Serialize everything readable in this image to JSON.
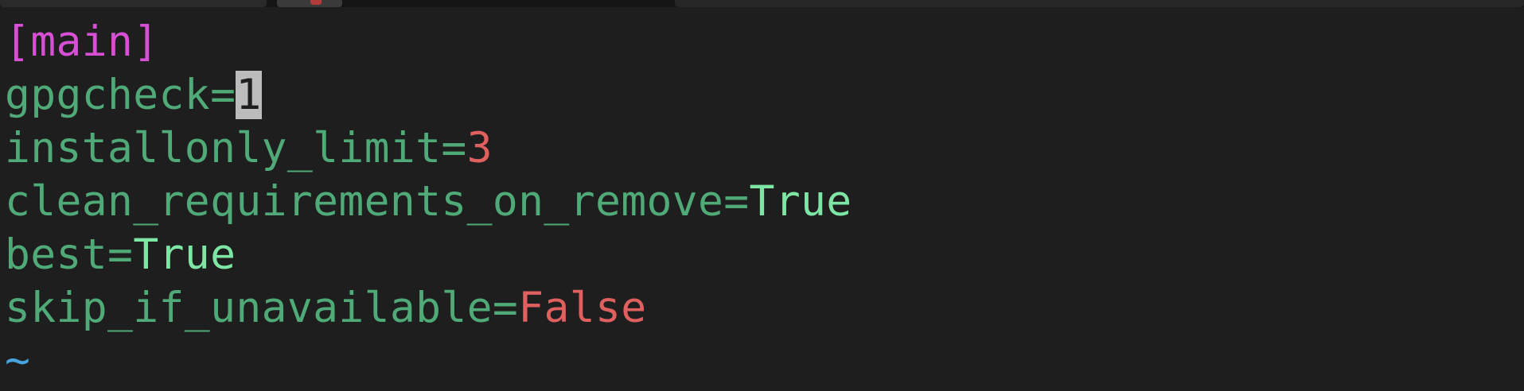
{
  "editor": {
    "section_header": "[main]",
    "lines": [
      {
        "key": "gpgcheck",
        "eq": "=",
        "value": "1"
      },
      {
        "key": "installonly_limit",
        "eq": "=",
        "value": "3"
      },
      {
        "key": "clean_requirements_on_remove",
        "eq": "=",
        "value": "True"
      },
      {
        "key": "best",
        "eq": "=",
        "value": "True"
      },
      {
        "key": "skip_if_unavailable",
        "eq": "=",
        "value": "False"
      }
    ],
    "empty_line_marker": "~"
  },
  "colors": {
    "background": "#1e1e1e",
    "section": "#d64fd4",
    "key": "#4faa78",
    "number": "#e06060",
    "true": "#7ee6a4",
    "false": "#e06060",
    "tilde": "#4aa3e0",
    "cursor": "#bcbcbc"
  }
}
